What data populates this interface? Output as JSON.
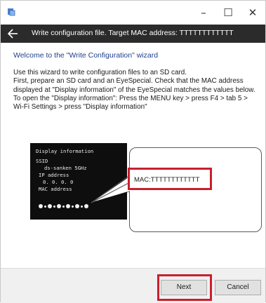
{
  "window": {
    "minimize_glyph": "–",
    "maximize_glyph": "☐",
    "close_glyph": "✕"
  },
  "header": {
    "title": "Write configuration file. Target MAC address: TTTTTTTTTTTT"
  },
  "wizard": {
    "welcome": "Welcome to the \"Write Configuration\" wizard",
    "instructions": [
      "Use this wizard to write configuration files to an SD card.",
      "First, prepare an SD card and an EyeSpecial. Check that the MAC address displayed at \"Display information\" of the EyeSpecial matches the values below.",
      "To open the \"Display information\": Press the MENU key > press F4 > tab 5 > Wi-Fi Settings > press \"Display information\""
    ]
  },
  "device_display": {
    "title": "Display information",
    "ssid_label": "SSID",
    "ssid_value": "ds-sanken 5GHz",
    "ip_label": "IP address",
    "ip_value": "0. 0. 0. 0",
    "mac_label": "MAC address"
  },
  "mac": {
    "text": "MAC:TTTTTTTTTTTT"
  },
  "buttons": {
    "next": "Next",
    "cancel": "Cancel"
  },
  "colors": {
    "header_bg": "#2b2b2b",
    "welcome_text": "#1f3e8c",
    "highlight": "#c8202e"
  }
}
